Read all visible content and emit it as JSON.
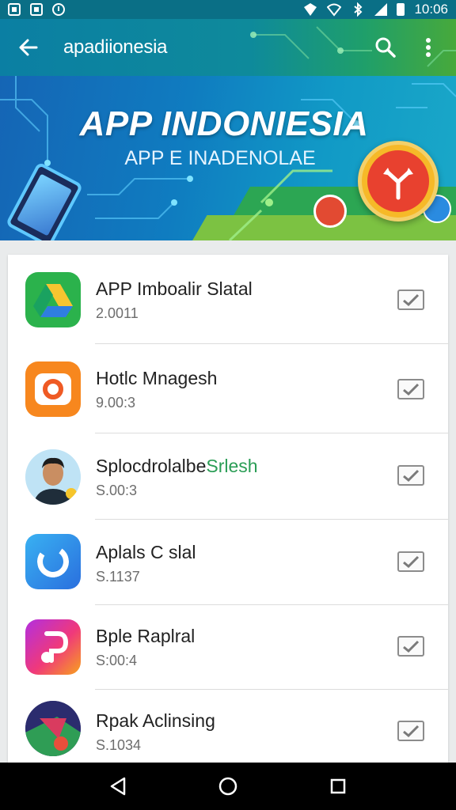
{
  "status_bar": {
    "time": "10:06",
    "left_icons": [
      "sim-icon",
      "media-icon",
      "sync-icon"
    ],
    "right_icons": [
      "location-icon",
      "wifi-icon",
      "bluetooth-icon",
      "signal-icon",
      "battery-icon"
    ]
  },
  "app_bar": {
    "title": "apadiionesia",
    "back_icon": "arrow-left-icon",
    "search_icon": "search-icon",
    "more_icon": "more-vertical-icon"
  },
  "banner": {
    "title": "APP INDONIESIA",
    "subtitle": "APP E INADENOLAE"
  },
  "apps": [
    {
      "title": "APP Imboalir Slatal",
      "sub": "2.0011",
      "icon": "drive-triangle-icon"
    },
    {
      "title": "Hotlc Mnagesh",
      "sub": "9.00:3",
      "icon": "camera-icon"
    },
    {
      "title": "Splocdrolalbe",
      "title_accent": "Srlesh",
      "sub": "S.00:3",
      "icon": "avatar-photo"
    },
    {
      "title": "Aplals C slal",
      "sub": "S.1137",
      "icon": "ring-icon"
    },
    {
      "title": "Bple Raplral",
      "sub": "S:00:4",
      "icon": "music-note-icon"
    },
    {
      "title": "Rpak Aclinsing",
      "sub": "S.1034",
      "icon": "map-shield-icon"
    }
  ],
  "colors": {
    "accent_green": "#2a9d55",
    "app_bar_start": "#0b7fa3",
    "app_bar_end": "#47a93b"
  },
  "nav": {
    "back_icon": "triangle-back-icon",
    "home_icon": "circle-home-icon",
    "recents_icon": "square-recents-icon"
  }
}
